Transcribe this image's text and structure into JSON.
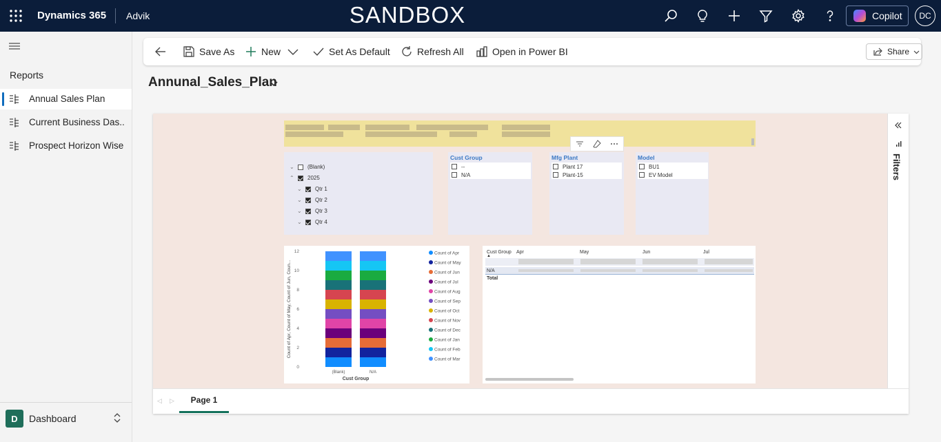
{
  "topbar": {
    "app_name": "Dynamics 365",
    "environment": "Advik",
    "banner": "SANDBOX",
    "copilot_label": "Copilot",
    "user_initials": "DC"
  },
  "sidebar": {
    "section_title": "Reports",
    "items": [
      {
        "label": "Annual Sales Plan",
        "active": true
      },
      {
        "label": "Current Business Das..."
      },
      {
        "label": "Prospect Horizon Wise"
      }
    ],
    "area": {
      "badge": "D",
      "label": "Dashboard"
    }
  },
  "commandbar": {
    "save_as": "Save As",
    "new": "New",
    "set_default": "Set As Default",
    "refresh_all": "Refresh All",
    "open_powerbi": "Open in Power BI",
    "share": "Share"
  },
  "report": {
    "title": "Annunal_Sales_Plan",
    "filters_label": "Filters",
    "page_tab": "Page 1",
    "date_slicer": {
      "rows": [
        {
          "label": "(Blank)",
          "checked": false,
          "level": 0
        },
        {
          "label": "2025",
          "checked": true,
          "level": 0
        },
        {
          "label": "Qtr 1",
          "checked": true,
          "level": 1
        },
        {
          "label": "Qtr 2",
          "checked": true,
          "level": 1
        },
        {
          "label": "Qtr 3",
          "checked": true,
          "level": 1
        },
        {
          "label": "Qtr 4",
          "checked": true,
          "level": 1
        }
      ]
    },
    "slicers": [
      {
        "title": "Cust Group",
        "options": [
          "--",
          "N/A"
        ]
      },
      {
        "title": "Mfg Plant",
        "options": [
          "Plant 17",
          "Plant-15"
        ]
      },
      {
        "title": "Model",
        "options": [
          "BU1",
          "EV Model"
        ]
      }
    ],
    "table": {
      "headers": [
        "Cust Group",
        "Apr",
        "May",
        "Jun",
        "Jul"
      ],
      "rows": [
        "",
        "N/A"
      ],
      "total_label": "Total"
    }
  },
  "chart_data": {
    "type": "bar",
    "stacked": true,
    "categories": [
      "(Blank)",
      "N/A"
    ],
    "xlabel": "Cust Group",
    "ylabel": "Count of Apr, Count of May, Count of Jun, Coun...",
    "ylim": [
      0,
      12
    ],
    "yticks": [
      0,
      2,
      4,
      6,
      8,
      10,
      12
    ],
    "legend_position": "right",
    "series": [
      {
        "name": "Count of Apr",
        "values": [
          1,
          1
        ],
        "color": "#118dff"
      },
      {
        "name": "Count of May",
        "values": [
          1,
          1
        ],
        "color": "#12239e"
      },
      {
        "name": "Count of Jun",
        "values": [
          1,
          1
        ],
        "color": "#e66c37"
      },
      {
        "name": "Count of Jul",
        "values": [
          1,
          1
        ],
        "color": "#6b007b"
      },
      {
        "name": "Count of Aug",
        "values": [
          1,
          1
        ],
        "color": "#e044a7"
      },
      {
        "name": "Count of Sep",
        "values": [
          1,
          1
        ],
        "color": "#744ec2"
      },
      {
        "name": "Count of Oct",
        "values": [
          1,
          1
        ],
        "color": "#d9b300"
      },
      {
        "name": "Count of Nov",
        "values": [
          1,
          1
        ],
        "color": "#d64550"
      },
      {
        "name": "Count of Dec",
        "values": [
          1,
          1
        ],
        "color": "#197278"
      },
      {
        "name": "Count of Jan",
        "values": [
          1,
          1
        ],
        "color": "#1aab40"
      },
      {
        "name": "Count of Feb",
        "values": [
          1,
          1
        ],
        "color": "#15c6f4"
      },
      {
        "name": "Count of Mar",
        "values": [
          1,
          1
        ],
        "color": "#4092ff"
      }
    ]
  }
}
